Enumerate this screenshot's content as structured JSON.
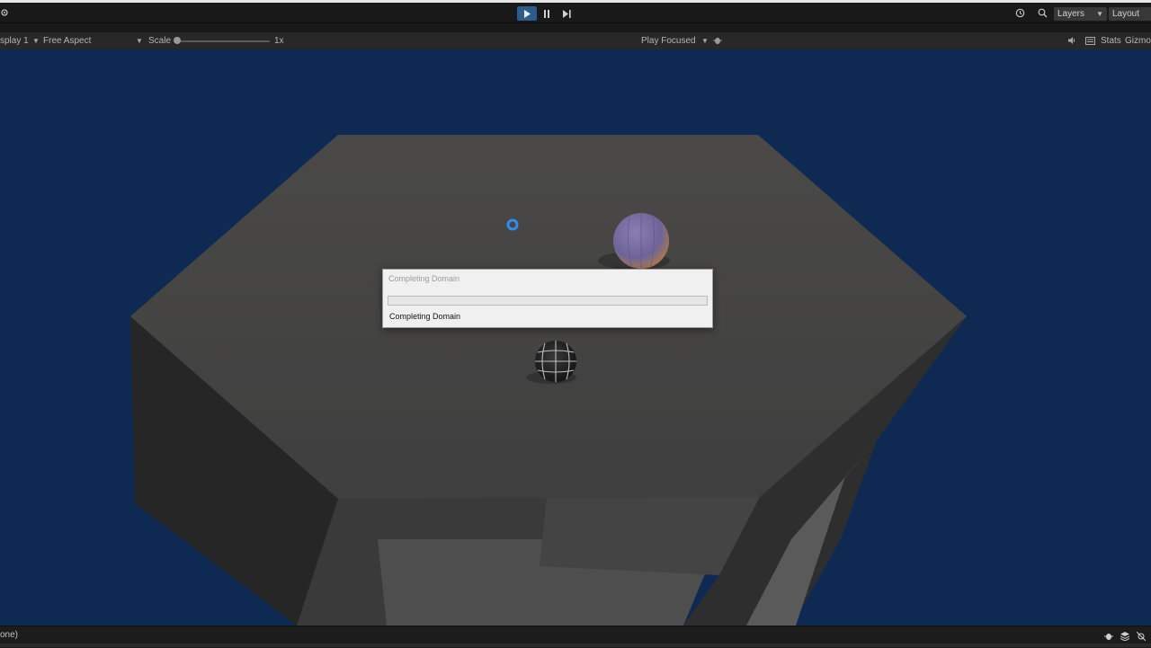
{
  "toolbar": {
    "left_icon": "settings-icon",
    "play_icon": "▶",
    "pause_icon": "❚❚",
    "step_icon": "▶|",
    "history_icon": "⟲",
    "search_icon": "⌕",
    "layers_label": "Layers",
    "layout_label": "Layout"
  },
  "game_view": {
    "display_label": "splay 1",
    "aspect_label": "Free Aspect",
    "scale_label": "Scale",
    "scale_value": "1x",
    "scale_fraction": 0.0,
    "play_mode_label": "Play Focused",
    "stats_label": "Stats",
    "gizmos_label": "Gizmos"
  },
  "dialog": {
    "title": "Completing Domain",
    "status": "Completing Domain",
    "progress": 0.0
  },
  "status_bar": {
    "text": "one)"
  },
  "colors": {
    "viewport_bg": "#0f2a52",
    "accent": "#2c5d8a",
    "cursor": "#2f8ef0"
  }
}
